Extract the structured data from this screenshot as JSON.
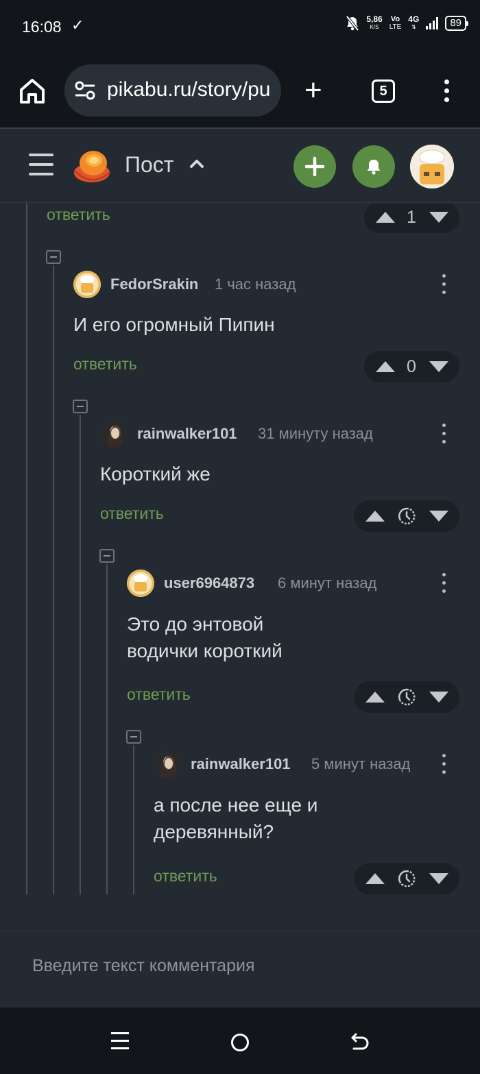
{
  "status": {
    "time": "16:08",
    "speed": "5,86",
    "speed_unit": "K/S",
    "volte_top": "Vo",
    "volte_bottom": "LTE",
    "network": "4G",
    "battery": "89"
  },
  "browser": {
    "url": "pikabu.ru/story/pu",
    "tab_count": "5"
  },
  "app": {
    "title": "Пост"
  },
  "colors": {
    "accent": "#6f9d55",
    "button_green": "#5b8c43",
    "background": "#242a31"
  },
  "top_comment": {
    "reply_label": "ответить",
    "score": "1"
  },
  "comments": [
    {
      "author": "FedorSrakin",
      "time": "1 час назад",
      "text": "И его огромный Пипин",
      "reply_label": "ответить",
      "score": "0"
    },
    {
      "author": "rainwalker101",
      "time": "31 минуту назад",
      "text": "Короткий же",
      "reply_label": "ответить"
    },
    {
      "author": "user6964873",
      "time": "6 минут назад",
      "text_line1": "Это до энтовой",
      "text_line2": "водички короткий",
      "reply_label": "ответить"
    },
    {
      "author": "rainwalker101",
      "time": "5 минут назад",
      "text_line1": "а после нее еще и",
      "text_line2": "деревянный?",
      "reply_label": "ответить"
    }
  ],
  "comment_input": {
    "placeholder": "Введите текст комментария"
  }
}
